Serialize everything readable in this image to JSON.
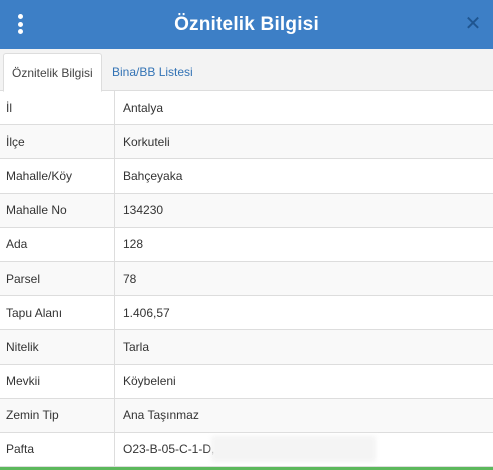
{
  "header": {
    "title": "Öznitelik Bilgisi",
    "menu_icon": "vertical-dots-icon",
    "close_icon": "close-icon",
    "close_glyph": "✕",
    "bg_color": "#3d7fc6"
  },
  "tabs": [
    {
      "label": "Öznitelik Bilgisi",
      "active": true
    },
    {
      "label": "Bina/BB Listesi",
      "active": false
    }
  ],
  "attributes": [
    {
      "key": "İl",
      "value": "Antalya"
    },
    {
      "key": "İlçe",
      "value": "Korkuteli"
    },
    {
      "key": "Mahalle/Köy",
      "value": "Bahçeyaka"
    },
    {
      "key": "Mahalle No",
      "value": "134230"
    },
    {
      "key": "Ada",
      "value": "128"
    },
    {
      "key": "Parsel",
      "value": "78"
    },
    {
      "key": "Tapu Alanı",
      "value": "1.406,57"
    },
    {
      "key": "Nitelik",
      "value": "Tarla"
    },
    {
      "key": "Mevkii",
      "value": "Köybeleni"
    },
    {
      "key": "Zemin Tip",
      "value": "Ana Taşınmaz"
    },
    {
      "key": "Pafta",
      "value": "O23-B-05-C-1-D,"
    }
  ]
}
